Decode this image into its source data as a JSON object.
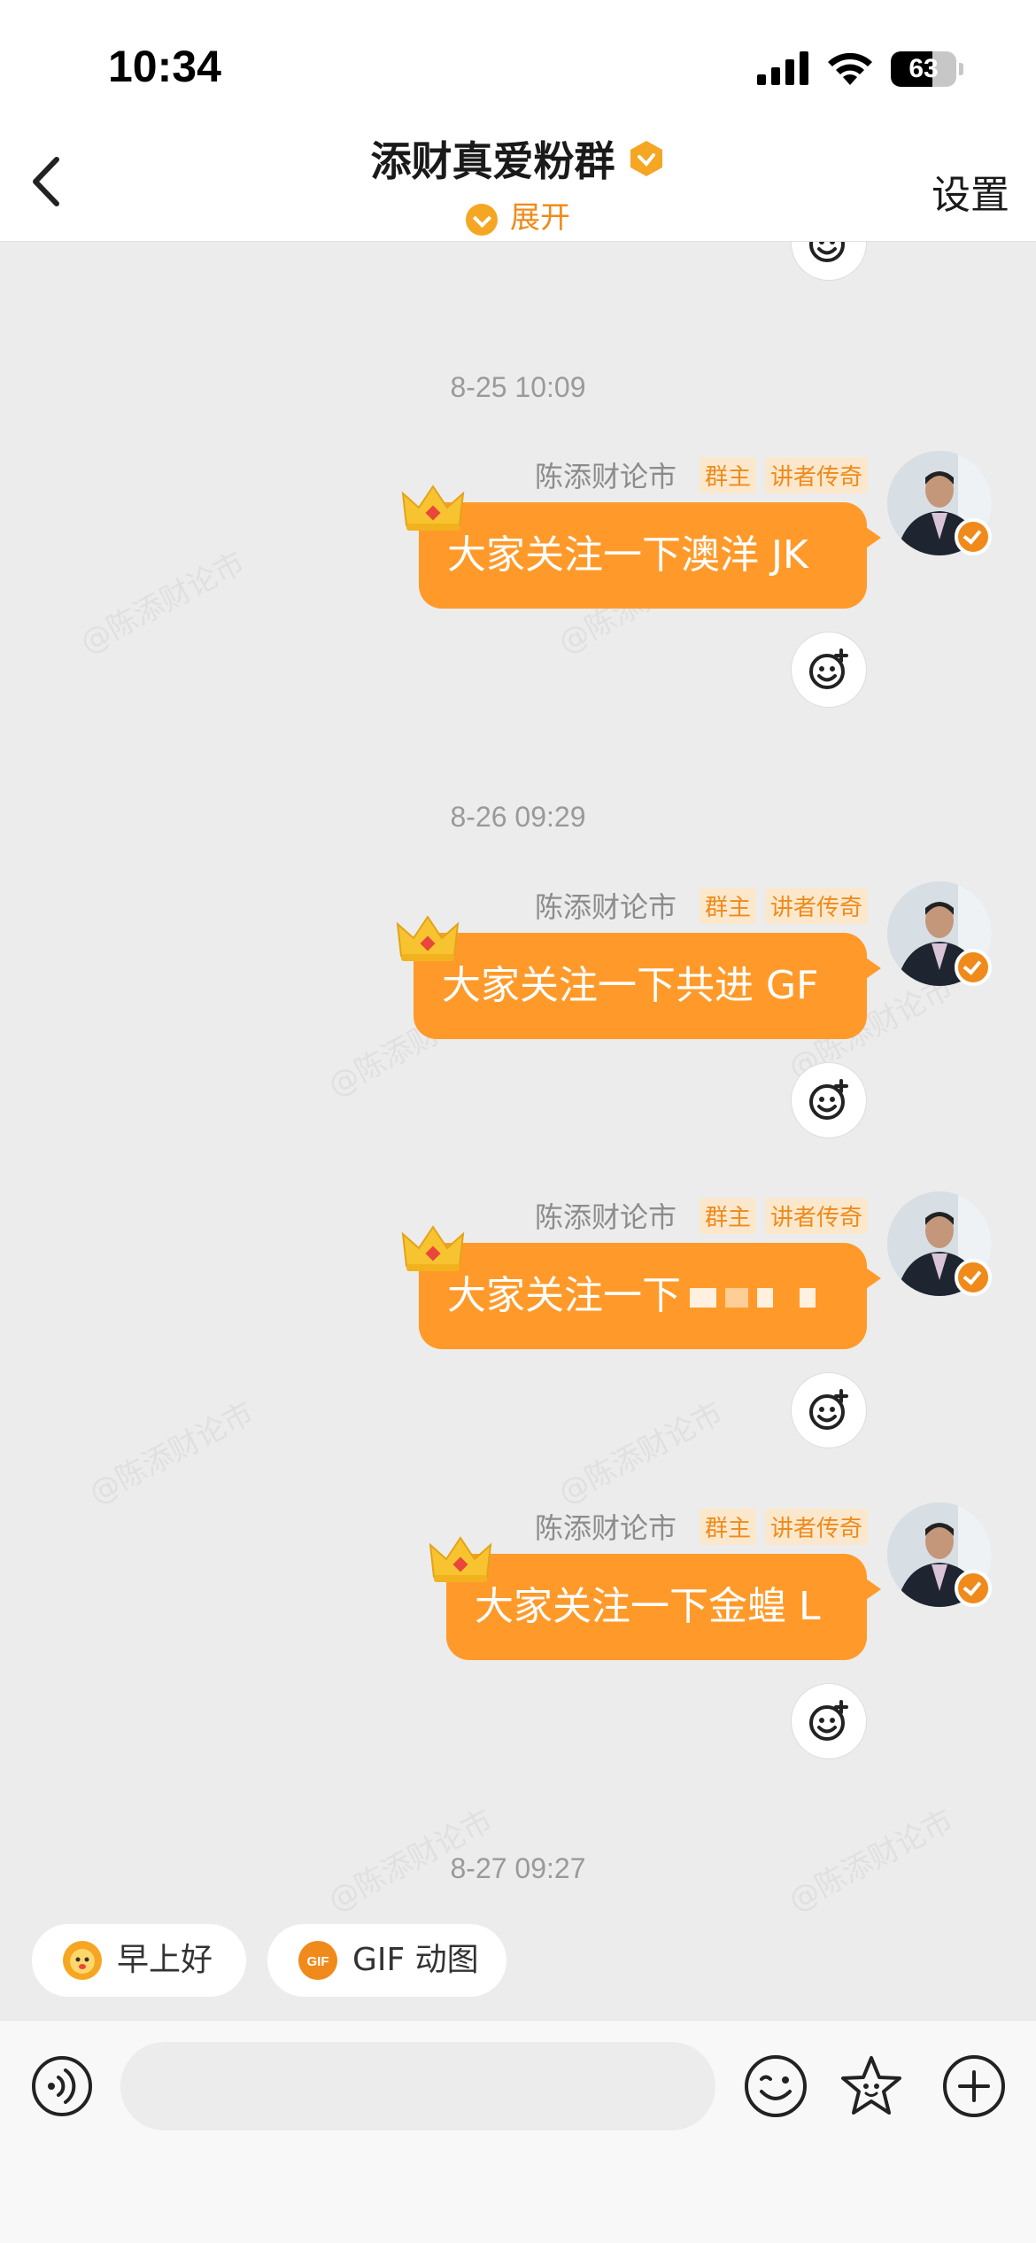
{
  "status_bar": {
    "time": "10:34",
    "battery_level": "63",
    "battery_fraction": 0.63
  },
  "header": {
    "title": "添财真爱粉群",
    "expand_label": "展开",
    "settings_label": "设置"
  },
  "watermark_text": "@陈添财论市",
  "messages": [
    {
      "timestamp": "8-25 10:09",
      "sender": "陈添财论市",
      "tags": [
        "群主",
        "讲者传奇"
      ],
      "text": "大家关注一下澳洋 JK"
    },
    {
      "timestamp": "8-26 09:29",
      "sender": "陈添财论市",
      "tags": [
        "群主",
        "讲者传奇"
      ],
      "text": "大家关注一下共进 GF"
    },
    {
      "timestamp": "",
      "sender": "陈添财论市",
      "tags": [
        "群主",
        "讲者传奇"
      ],
      "text": "大家关注一下"
    },
    {
      "timestamp": "",
      "sender": "陈添财论市",
      "tags": [
        "群主",
        "讲者传奇"
      ],
      "text": "大家关注一下金蝗 L"
    }
  ],
  "last_timestamp": "8-27 09:27",
  "quick_replies": [
    {
      "label": "早上好",
      "icon": "sun-face-icon"
    },
    {
      "label": "GIF 动图",
      "icon": "gif-icon"
    }
  ],
  "input": {
    "placeholder": ""
  },
  "colors": {
    "bubble": "#ff9a2a",
    "accent": "#f08a1a",
    "tag_bg": "#fbe8cc"
  }
}
